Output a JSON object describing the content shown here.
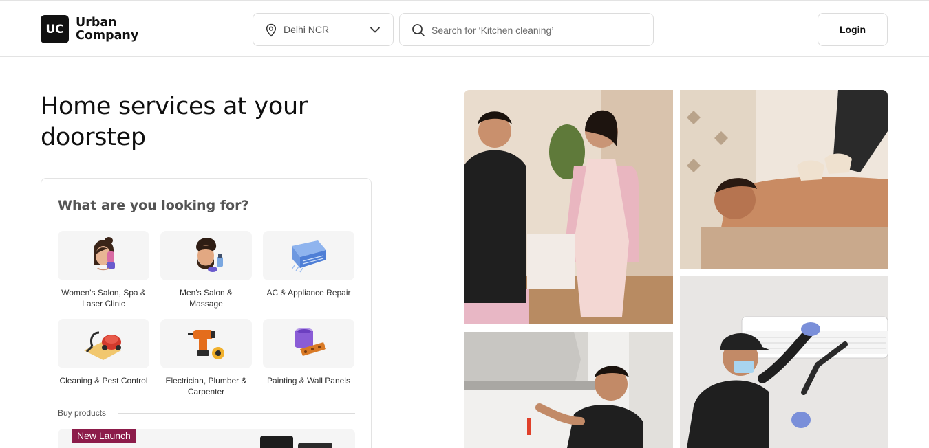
{
  "header": {
    "logo_line1": "Urban",
    "logo_line2": "Company",
    "logo_mark": "UC",
    "location": "Delhi NCR",
    "search_placeholder": "Search for ‘Kitchen cleaning’",
    "login_label": "Login"
  },
  "hero": {
    "title": "Home services at your doorstep"
  },
  "finder": {
    "title": "What are you looking for?",
    "categories": [
      {
        "label": "Women's Salon, Spa & Laser Clinic",
        "icon": "woman-face-icon"
      },
      {
        "label": "Men's Salon & Massage",
        "icon": "man-face-icon"
      },
      {
        "label": "AC & Appliance Repair",
        "icon": "ac-unit-icon"
      },
      {
        "label": "Cleaning & Pest Control",
        "icon": "vacuum-cleaner-icon"
      },
      {
        "label": "Electrician, Plumber & Carpenter",
        "icon": "drill-icon"
      },
      {
        "label": "Painting & Wall Panels",
        "icon": "paint-bucket-icon"
      }
    ],
    "buy_label": "Buy products",
    "promo_badge": "New Launch"
  },
  "colors": {
    "brand": "#111111",
    "badge": "#8c1c4a",
    "tile_bg": "#f5f5f5",
    "border": "#e3e3e3"
  }
}
